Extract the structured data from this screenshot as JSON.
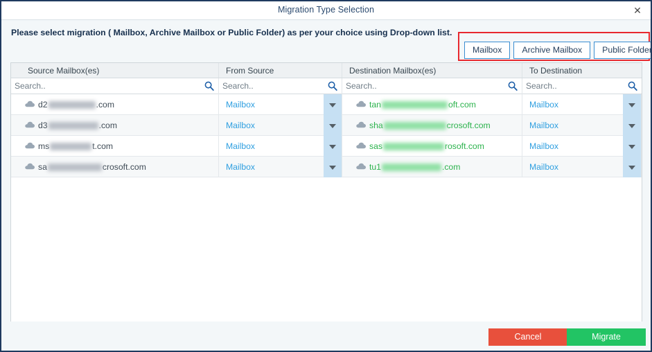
{
  "window": {
    "title": "Migration Type Selection",
    "close_icon": "close-icon",
    "close_label": "✕"
  },
  "instruction": {
    "text": "Please select migration ( Mailbox, Archive Mailbox or Public Folder) as per your choice using Drop-down list."
  },
  "migration_types": {
    "highlight_color": "#e8292f",
    "buttons": [
      {
        "label": "Mailbox"
      },
      {
        "label": "Archive Mailbox"
      },
      {
        "label": "Public Folder"
      }
    ]
  },
  "table": {
    "columns": [
      {
        "header": "Source Mailbox(es)"
      },
      {
        "header": "From Source"
      },
      {
        "header": "Destination Mailbox(es)"
      },
      {
        "header": "To Destination"
      }
    ],
    "search": {
      "placeholder": "Search..",
      "value": "",
      "icon": "search-icon"
    },
    "rows": [
      {
        "source_prefix": "d2",
        "source_suffix": ".com",
        "from_source": "Mailbox",
        "dest_prefix": "tan",
        "dest_suffix": "oft.com",
        "to_destination": "Mailbox"
      },
      {
        "source_prefix": "d3",
        "source_suffix": ".com",
        "from_source": "Mailbox",
        "dest_prefix": "sha",
        "dest_suffix": "crosoft.com",
        "to_destination": "Mailbox"
      },
      {
        "source_prefix": "ms",
        "source_suffix": "t.com",
        "from_source": "Mailbox",
        "dest_prefix": "sas",
        "dest_suffix": "rosoft.com",
        "to_destination": "Mailbox"
      },
      {
        "source_prefix": "sa",
        "source_suffix": "crosoft.com",
        "from_source": "Mailbox",
        "dest_prefix": "tu1",
        "dest_suffix": ".com",
        "to_destination": "Mailbox"
      }
    ]
  },
  "footer": {
    "cancel_label": "Cancel",
    "migrate_label": "Migrate",
    "cancel_color": "#e8503c",
    "migrate_color": "#22c464"
  }
}
